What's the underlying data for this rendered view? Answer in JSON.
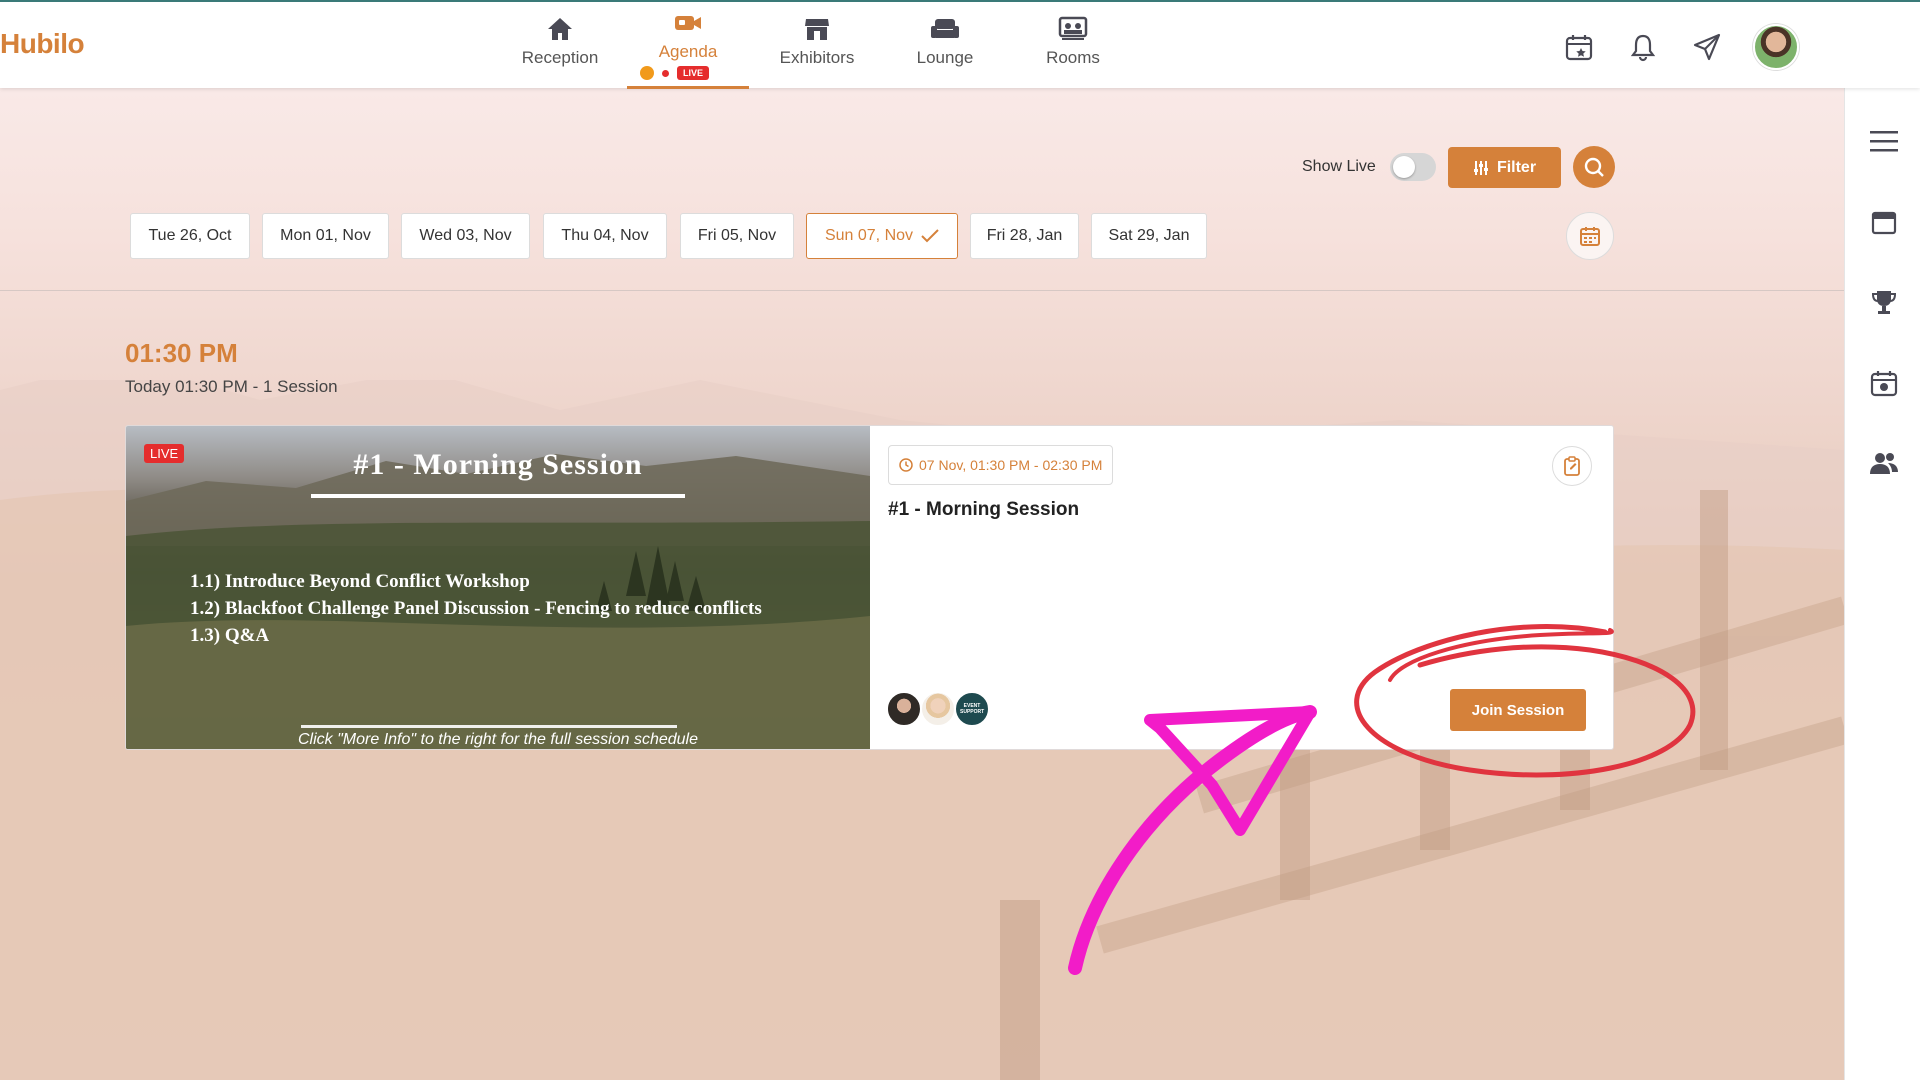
{
  "brand": {
    "logo_text": "Hubilo"
  },
  "nav": {
    "items": [
      {
        "label": "Reception",
        "icon": "home-icon"
      },
      {
        "label": "Agenda",
        "icon": "video-camera-icon",
        "badge": "LIVE"
      },
      {
        "label": "Exhibitors",
        "icon": "store-icon"
      },
      {
        "label": "Lounge",
        "icon": "sofa-icon"
      },
      {
        "label": "Rooms",
        "icon": "presentation-icon"
      }
    ],
    "active": "Agenda"
  },
  "header_icons": [
    "calendar-star-icon",
    "bell-icon",
    "send-icon",
    "avatar"
  ],
  "sidebar_icons": [
    "menu-icon",
    "card-icon",
    "trophy-icon",
    "calendar-camera-icon",
    "people-icon"
  ],
  "filters": {
    "show_live_label": "Show Live",
    "show_live_on": false,
    "filter_label": "Filter"
  },
  "dates": [
    {
      "label": "Tue 26, Oct"
    },
    {
      "label": "Mon 01, Nov"
    },
    {
      "label": "Wed 03, Nov"
    },
    {
      "label": "Thu 04, Nov"
    },
    {
      "label": "Fri 05, Nov"
    },
    {
      "label": "Sun 07, Nov",
      "selected": true
    },
    {
      "label": "Fri 28, Jan"
    },
    {
      "label": "Sat 29, Jan"
    }
  ],
  "slot": {
    "time": "01:30 PM",
    "subtitle": "Today 01:30 PM - 1  Session"
  },
  "session": {
    "live_badge": "LIVE",
    "thumb_title": "#1 - Morning Session",
    "agenda_lines": [
      "1.1) Introduce Beyond Conflict Workshop",
      "1.2) Blackfoot Challenge Panel Discussion - Fencing to reduce conflicts",
      "1.3) Q&A"
    ],
    "thumb_note": "Click \"More Info\" to the right for the full session schedule",
    "time_range": "07 Nov, 01:30 PM - 02:30 PM",
    "title": "#1 - Morning Session",
    "speaker_badge_text": "EVENT SUPPORT",
    "join_label": "Join Session"
  },
  "colors": {
    "accent": "#d5813a",
    "live": "#e52d2d",
    "annotation_circle": "#e0343f",
    "annotation_arrow": "#f21cc8"
  }
}
